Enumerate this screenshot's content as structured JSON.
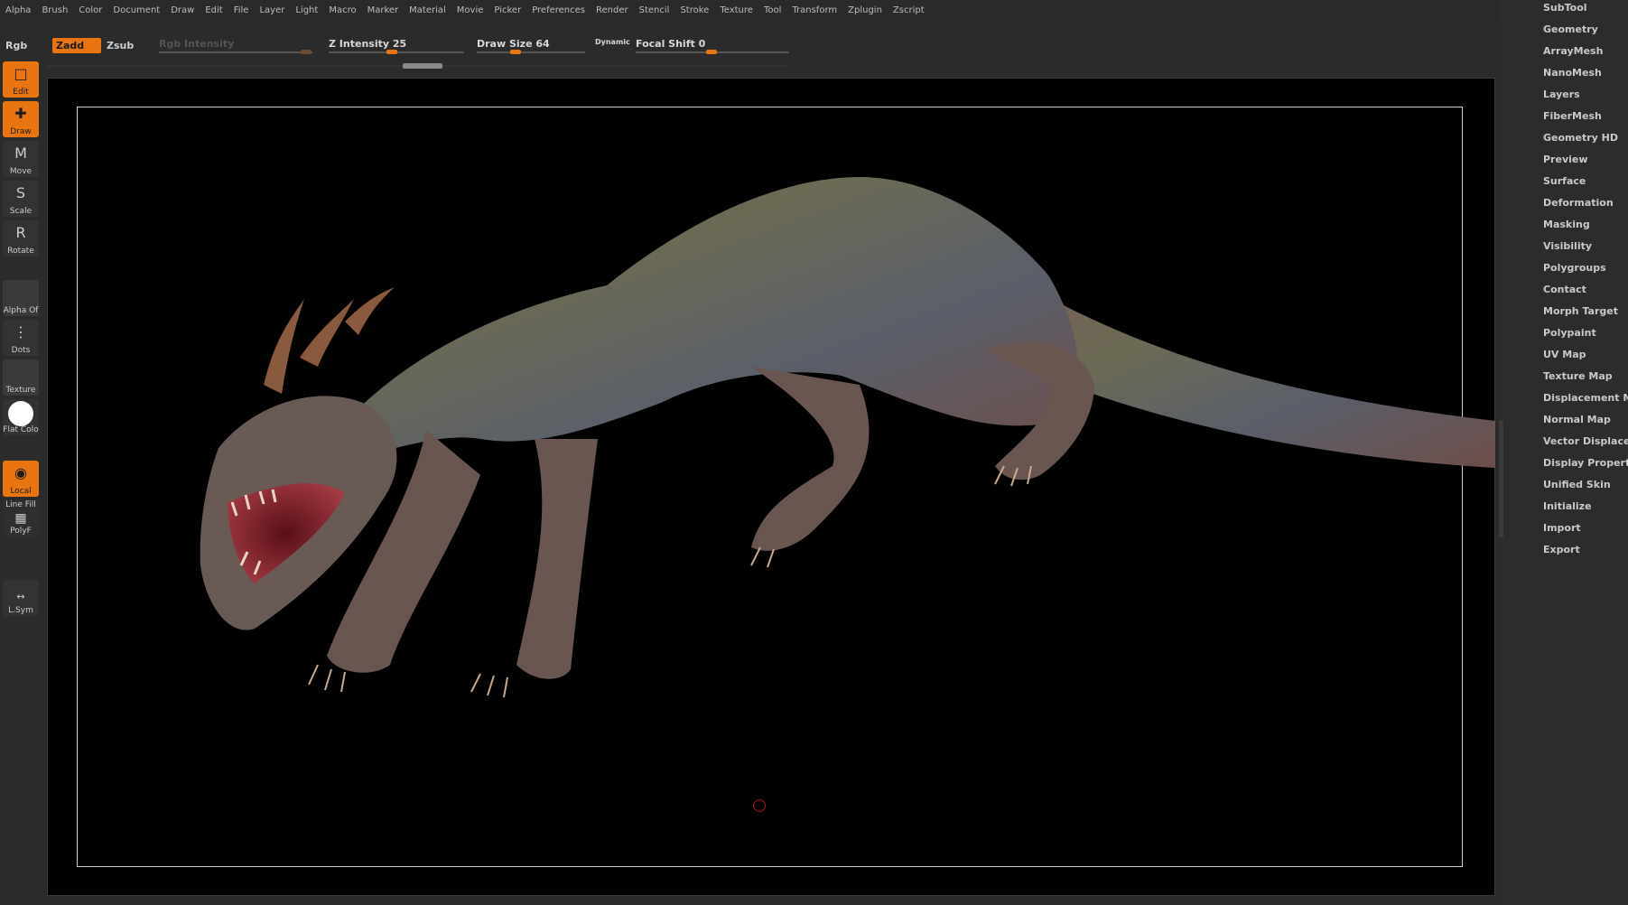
{
  "menu": [
    "Alpha",
    "Brush",
    "Color",
    "Document",
    "Draw",
    "Edit",
    "File",
    "Layer",
    "Light",
    "Macro",
    "Marker",
    "Material",
    "Movie",
    "Picker",
    "Preferences",
    "Render",
    "Stencil",
    "Stroke",
    "Texture",
    "Tool",
    "Transform",
    "Zplugin",
    "Zscript"
  ],
  "toolbar": {
    "rgb": "Rgb",
    "zadd": "Zadd",
    "zsub": "Zsub",
    "rgb_intensity": "Rgb Intensity",
    "z_intensity": "Z Intensity 25",
    "draw_size": "Draw Size 64",
    "dynamic": "Dynamic",
    "focal_shift": "Focal Shift 0"
  },
  "left_tools": {
    "edit": "Edit",
    "draw": "Draw",
    "move": "Move",
    "scale": "Scale",
    "rotate": "Rotate",
    "alpha": "Alpha Of",
    "dots": "Dots",
    "texture": "Texture",
    "flat_color": "Flat Colo",
    "local": "Local",
    "line_fill": "Line Fill",
    "polyf": "PolyF",
    "lsym": "L.Sym"
  },
  "subtool_panel": [
    "SubTool",
    "Geometry",
    "ArrayMesh",
    "NanoMesh",
    "Layers",
    "FiberMesh",
    "Geometry HD",
    "Preview",
    "Surface",
    "Deformation",
    "Masking",
    "Visibility",
    "Polygroups",
    "Contact",
    "Morph Target",
    "Polypaint",
    "UV Map",
    "Texture Map",
    "Displacement Ma",
    "Normal Map",
    "Vector Displace",
    "Display Properti",
    "Unified Skin",
    "Initialize",
    "Import",
    "Export"
  ],
  "colors": {
    "accent": "#e8750f",
    "background": "#2b2b2b",
    "canvas": "#000000"
  }
}
